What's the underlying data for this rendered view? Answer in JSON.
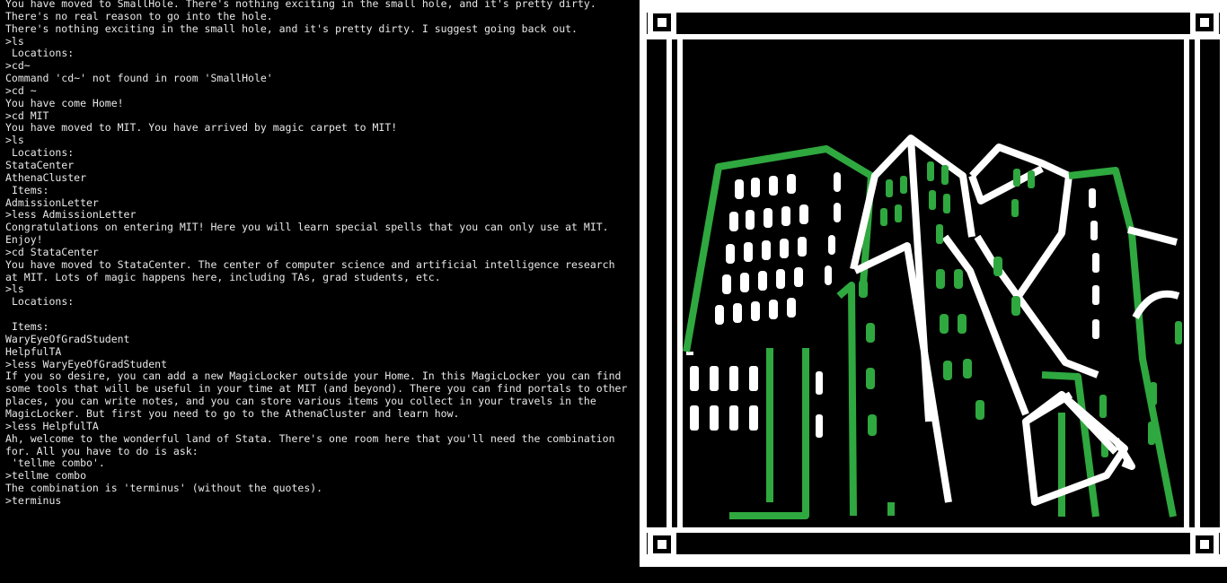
{
  "terminal": {
    "lines": [
      "You have moved to SmallHole. There's nothing exciting in the small hole, and it's pretty dirty. There's no real reason to go into the hole.",
      "There's nothing exciting in the small hole, and it's pretty dirty. I suggest going back out.",
      ">ls",
      " Locations:",
      ">cd~",
      "Command 'cd~' not found in room 'SmallHole'",
      ">cd ~",
      "You have come Home!",
      ">cd MIT",
      "You have moved to MIT. You have arrived by magic carpet to MIT!",
      ">ls",
      " Locations:",
      "StataCenter",
      "AthenaCluster",
      " Items:",
      "AdmissionLetter",
      ">less AdmissionLetter",
      "Congratulations on entering MIT! Here you will learn special spells that you can only use at MIT. Enjoy!",
      ">cd StataCenter",
      "You have moved to StataCenter. The center of computer science and artificial intelligence research at MIT. Lots of magic happens here, including TAs, grad students, etc.",
      ">ls",
      " Locations:",
      "",
      " Items:",
      "WaryEyeOfGradStudent",
      "HelpfulTA",
      ">less WaryEyeOfGradStudent",
      "If you so desire, you can add a new MagicLocker outside your Home. In this MagicLocker you can find some tools that will be useful in your time at MIT (and beyond). There you can find portals to other places, you can write notes, and you can store various items you collect in your travels in the MagicLocker. But first you need to go to the AthenaCluster and learn how.",
      ">less HelpfulTA",
      "Ah, welcome to the wonderful land of Stata. There's one room here that you'll need the combination for. All you have to do is ask:",
      " 'tellme combo'.",
      ">tellme combo",
      "The combination is 'terminus' (without the quotes).",
      ">terminus"
    ]
  },
  "art": {
    "subject": "stata-center-pixel-art",
    "colors": {
      "background": "#000000",
      "frame": "#ffffff",
      "building_green": "#2fa83f",
      "building_white": "#ffffff"
    }
  }
}
